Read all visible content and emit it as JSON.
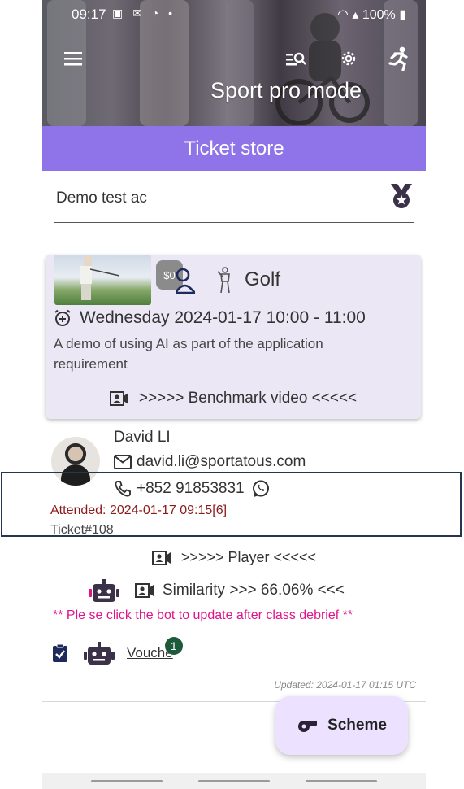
{
  "status_bar": {
    "time": "09:17",
    "battery": "100%"
  },
  "header": {
    "title": "Sport pro mode",
    "banner": "Ticket store"
  },
  "search": {
    "value": "Demo test ac"
  },
  "event": {
    "price": "$0",
    "sport": "Golf",
    "when": "Wednesday 2024-01-17 10:00 - 11:00",
    "description": "A demo of using AI as part of the application requirement",
    "video_link": ">>>>> Benchmark video <<<<<"
  },
  "player": {
    "name": "David LI",
    "email": "david.li@sportatous.com",
    "phone": "+852 91853831",
    "attended": "Attended: 2024-01-17 09:15[6]",
    "ticket": "Ticket#108",
    "player_link": ">>>>> Player <<<<<",
    "similarity": "Similarity >>> 66.06% <<<",
    "notice": "** Ple  se click the bot to update after class debrief **",
    "voucher_label": "Vouche",
    "voucher_count": "1"
  },
  "footer": {
    "updated": "Updated: 2024-01-17 01:15 UTC",
    "fab_label": "Scheme"
  },
  "colors": {
    "accent": "#8e74e8",
    "fab_bg": "#ece2ff",
    "notice": "#e0148a",
    "attended": "#8b1a1a"
  }
}
